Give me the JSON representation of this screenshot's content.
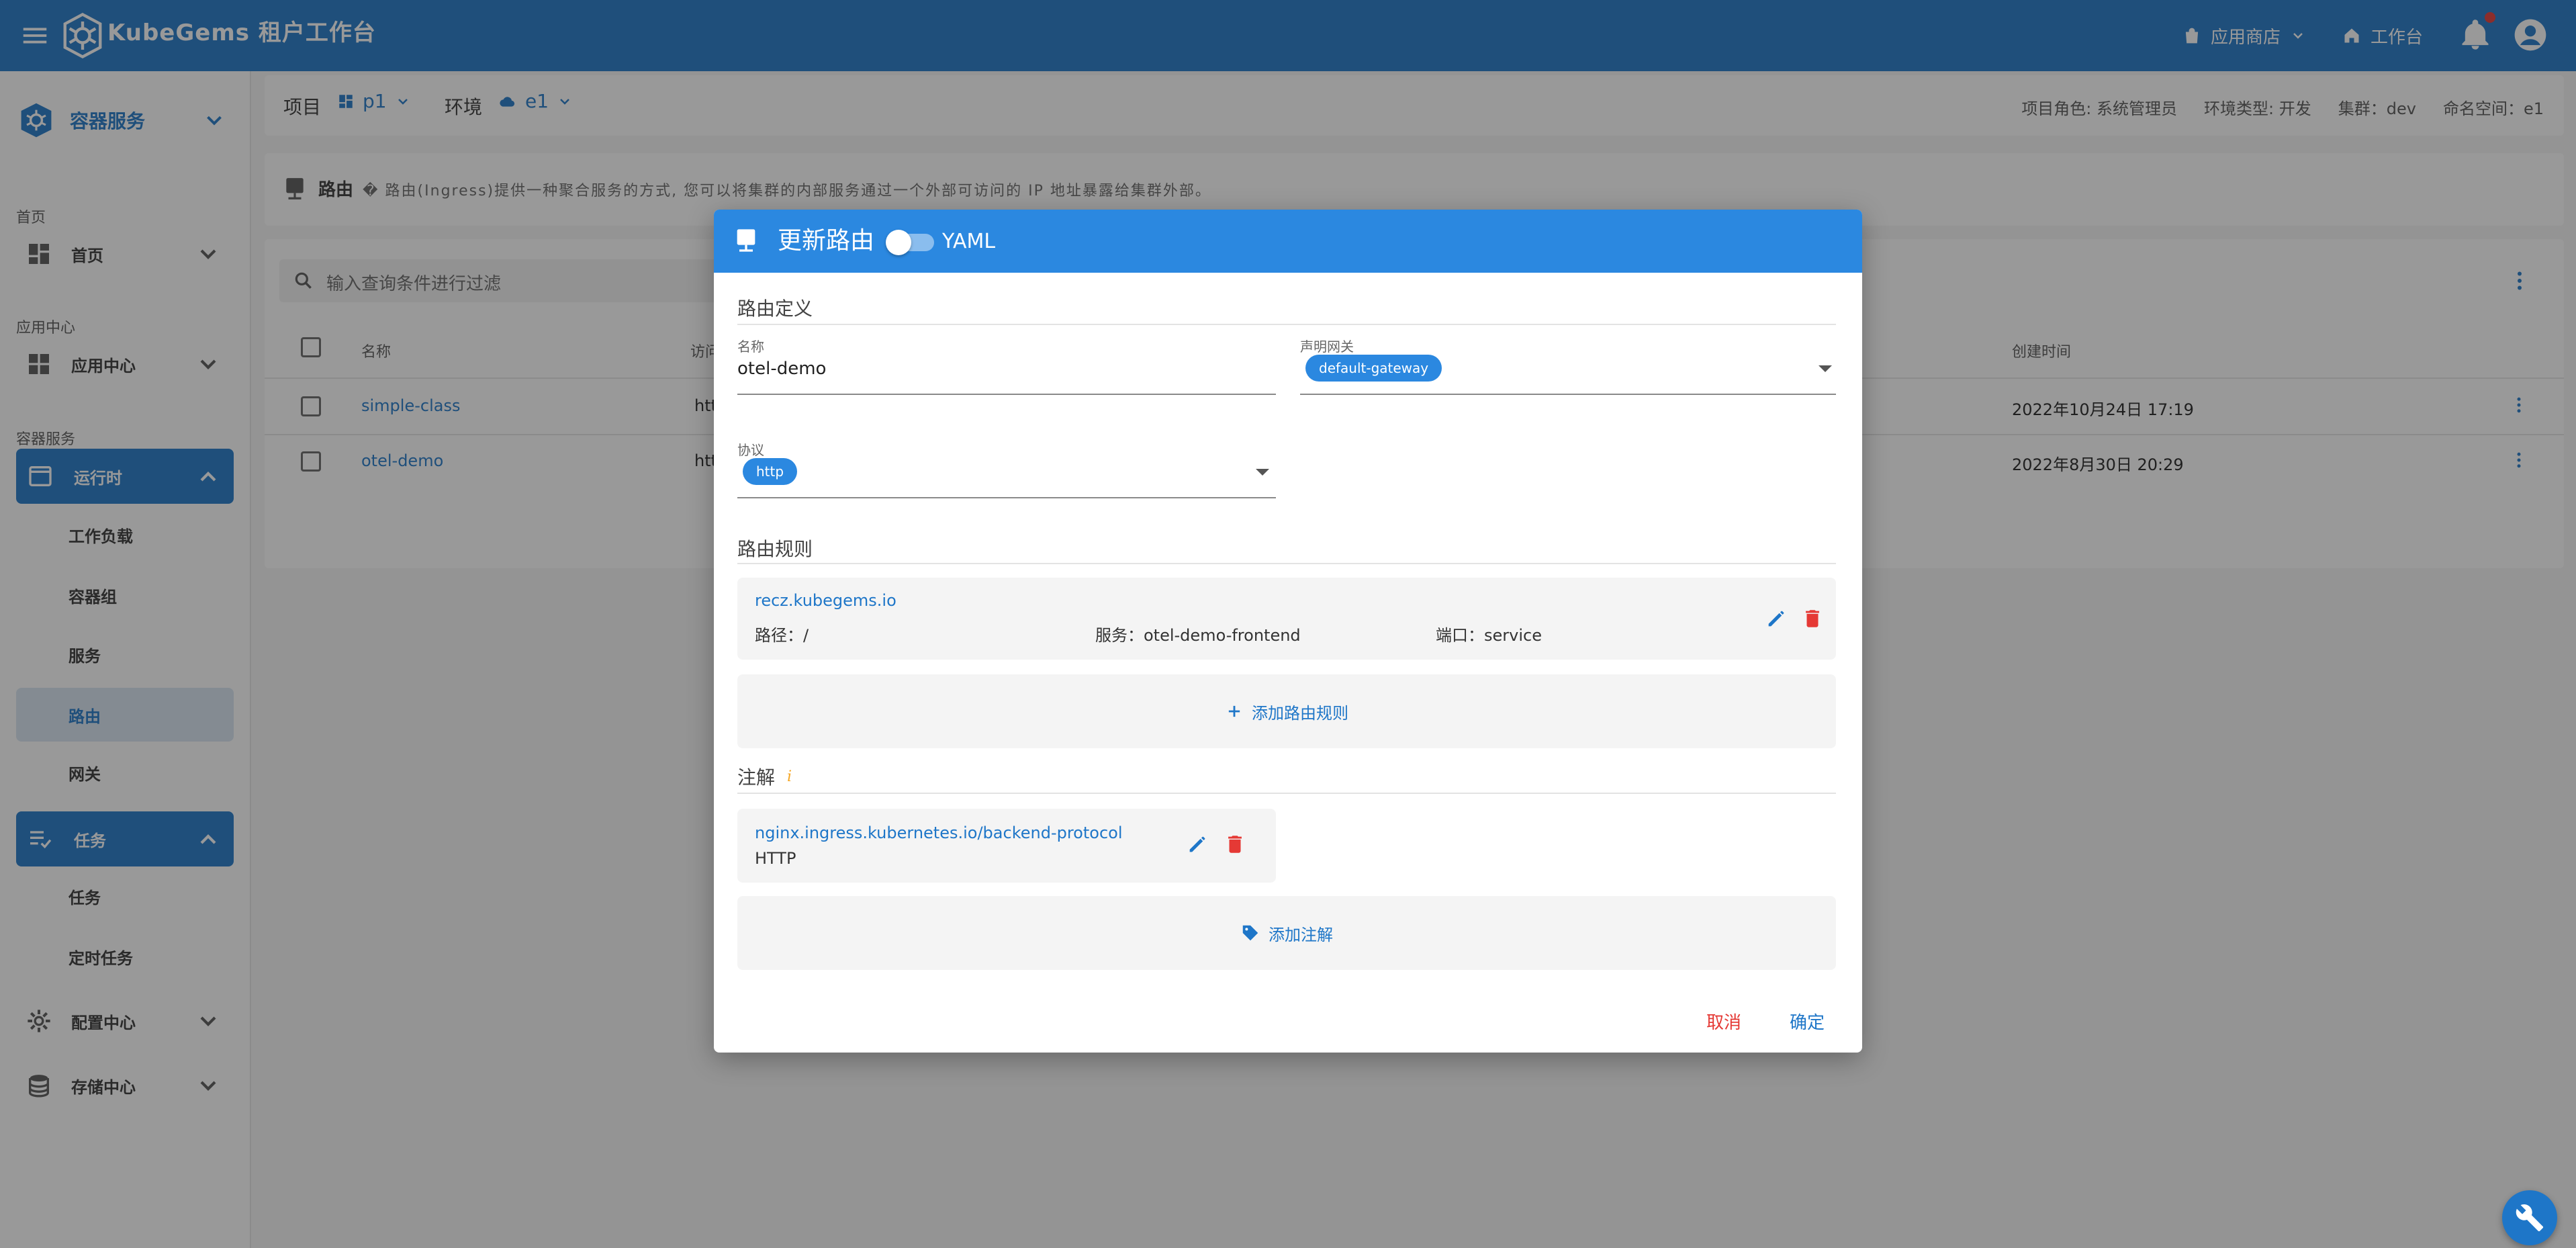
{
  "appbar": {
    "title": "KubeGems 租户工作台",
    "store_label": "应用商店",
    "workbench_label": "工作台",
    "menu_icon": "menu-icon",
    "notification_icon": "bell-icon",
    "account_icon": "account-circle-icon"
  },
  "sidebar": {
    "service_title": "容器服务",
    "sections": [
      {
        "caption": "首页",
        "item": "首页"
      },
      {
        "caption": "应用中心",
        "item": "应用中心"
      },
      {
        "caption": "容器服务"
      }
    ],
    "runtime": {
      "label": "运行时",
      "children": [
        "工作负载",
        "容器组",
        "服务",
        "路由",
        "网关"
      ]
    },
    "jobs": {
      "label": "任务",
      "children": [
        "任务",
        "定时任务"
      ]
    },
    "config_center": "配置中心",
    "storage_center": "存储中心"
  },
  "projbar": {
    "project_label": "项目",
    "project_value": "p1",
    "env_label": "环境",
    "env_value": "e1",
    "meta": [
      "项目角色: 系统管理员",
      "环境类型: 开发",
      "集群：dev",
      "命名空间：e1"
    ]
  },
  "desc": {
    "title": "路由",
    "text": "� 路由(Ingress)提供一种聚合服务的方式, 您可以将集群的内部服务通过一个外部可访问的 IP 地址暴露给集群外部。"
  },
  "table": {
    "search_placeholder": "输入查询条件进行过滤",
    "headers": {
      "name": "名称",
      "access": "访问",
      "created": "创建时间"
    },
    "rows": [
      {
        "name": "simple-class",
        "access": "htt",
        "created": "2022年10月24日 17:19"
      },
      {
        "name": "otel-demo",
        "access": "htt",
        "created": "2022年8月30日 20:29"
      }
    ]
  },
  "dialog": {
    "title": "更新路由",
    "yaml_label": "YAML",
    "def_section": "路由定义",
    "name_label": "名称",
    "name_value": "otel-demo",
    "gateway_label": "声明网关",
    "gateway_value": "default-gateway",
    "protocol_label": "协议",
    "protocol_value": "http",
    "rules_section": "路由规则",
    "rule": {
      "host": "recz.kubegems.io",
      "path": "路径：/",
      "service": "服务：otel-demo-frontend",
      "port": "端口：service"
    },
    "add_rule": "添加路由规则",
    "anno_section": "注解",
    "anno_info_mark": "i",
    "annotation": {
      "key": "nginx.ingress.kubernetes.io/backend-protocol",
      "value": "HTTP"
    },
    "add_anno": "添加注解",
    "cancel": "取消",
    "confirm": "确定"
  },
  "colors": {
    "primary": "#1e76c8",
    "header_dialog": "#2b88e0",
    "danger": "#e53935"
  }
}
